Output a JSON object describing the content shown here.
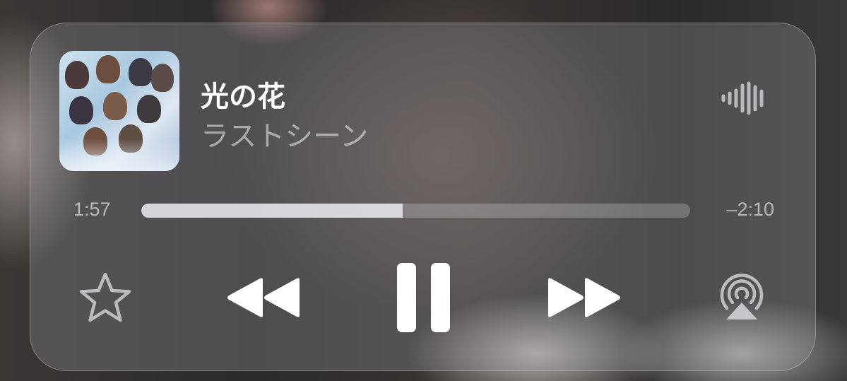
{
  "now_playing": {
    "title": "光の花",
    "artist": "ラストシーン",
    "artwork_icon": "album-artwork"
  },
  "progress": {
    "elapsed": "1:57",
    "remaining": "–2:10",
    "fraction": 0.476
  },
  "controls": {
    "favorite_icon": "star-outline-icon",
    "rewind_icon": "rewind-icon",
    "playpause_icon": "pause-icon",
    "forward_icon": "fast-forward-icon",
    "airplay_icon": "airplay-icon",
    "waveform_icon": "audio-waveform-icon"
  },
  "colors": {
    "panel": "#8f8f95",
    "text_primary": "#ffffff",
    "text_secondary": "#c9c9ce",
    "progress_fill": "#ebebf0"
  }
}
